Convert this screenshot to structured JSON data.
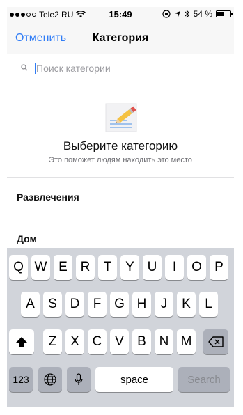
{
  "status_bar": {
    "carrier": "Tele2 RU",
    "time": "15:49",
    "battery_percent": "54 %",
    "battery_level": 0.54,
    "icons": [
      "signal-dots",
      "wifi-icon",
      "rotation-lock-icon",
      "location-icon",
      "bluetooth-icon",
      "battery-icon"
    ]
  },
  "nav": {
    "cancel_label": "Отменить",
    "title": "Категория"
  },
  "search": {
    "placeholder": "Поиск категории",
    "value": ""
  },
  "empty_state": {
    "title": "Выберите категорию",
    "subtitle": "Это поможет людям находить это место"
  },
  "categories": [
    {
      "label": "Развлечения"
    },
    {
      "label": "Дом"
    }
  ],
  "keyboard": {
    "row1": [
      "Q",
      "W",
      "E",
      "R",
      "T",
      "Y",
      "U",
      "I",
      "O",
      "P"
    ],
    "row2": [
      "A",
      "S",
      "D",
      "F",
      "G",
      "H",
      "J",
      "K",
      "L"
    ],
    "row3": [
      "Z",
      "X",
      "C",
      "V",
      "B",
      "N",
      "M"
    ],
    "numbers_label": "123",
    "space_label": "space",
    "search_label": "Search"
  },
  "colors": {
    "accent": "#2f7cf6",
    "keyboard_bg": "#d1d4da",
    "dark_key": "#acb0ba"
  }
}
